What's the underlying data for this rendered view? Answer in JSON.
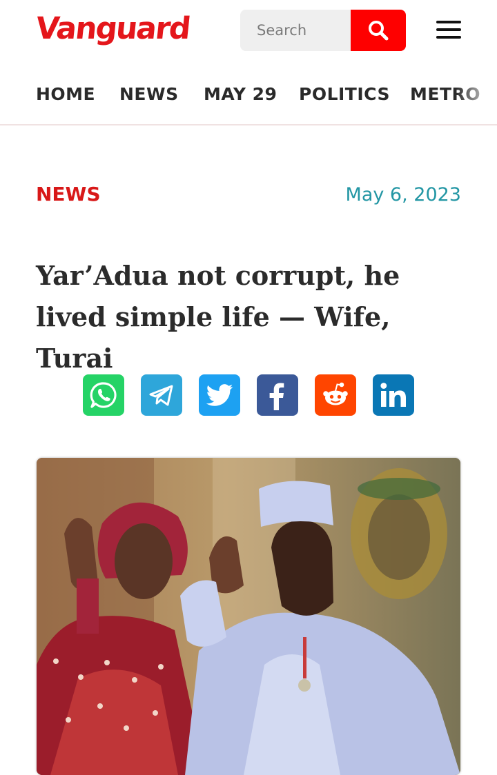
{
  "header": {
    "logo_text": "Vanguard",
    "search_placeholder": "Search"
  },
  "nav": {
    "items": [
      "HOME",
      "NEWS",
      "MAY 29",
      "POLITICS",
      "METRO"
    ]
  },
  "article": {
    "category": "NEWS",
    "date": "May 6, 2023",
    "headline": "Yar’Adua not corrupt, he lived simple life — Wife, Turai"
  },
  "share": {
    "buttons": [
      "whatsapp",
      "telegram",
      "twitter",
      "facebook",
      "reddit",
      "linkedin"
    ]
  },
  "colors": {
    "brand_red": "#e4161b",
    "search_red": "#fe0000",
    "date_teal": "#2296a4",
    "whatsapp": "#25d366",
    "telegram": "#2ea6da",
    "twitter": "#1da1f2",
    "facebook": "#3b5998",
    "reddit": "#ff4500",
    "linkedin": "#0a77b5"
  }
}
